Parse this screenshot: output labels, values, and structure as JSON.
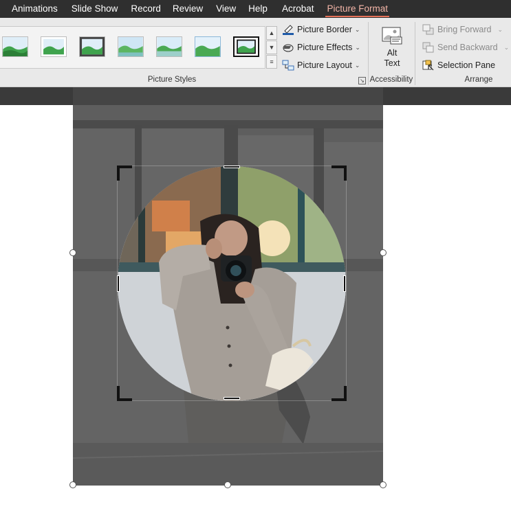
{
  "menu": {
    "tabs": [
      {
        "label": "Animations",
        "active": false
      },
      {
        "label": "Slide Show",
        "active": false
      },
      {
        "label": "Record",
        "active": false
      },
      {
        "label": "Review",
        "active": false
      },
      {
        "label": "View",
        "active": false
      },
      {
        "label": "Help",
        "active": false
      },
      {
        "label": "Acrobat",
        "active": false
      },
      {
        "label": "Picture Format",
        "active": true
      }
    ]
  },
  "ribbon": {
    "picture_styles": {
      "group_label": "Picture Styles",
      "thumbnail_icon": "landscape-thumbnail-icon",
      "commands": {
        "border": "Picture Border",
        "effects": "Picture Effects",
        "layout": "Picture Layout"
      }
    },
    "accessibility": {
      "group_label": "Accessibility",
      "alt_text_line1": "Alt",
      "alt_text_line2": "Text"
    },
    "arrange": {
      "group_label": "Arrange",
      "bring_forward": "Bring Forward",
      "send_backward": "Send Backward",
      "selection_pane": "Selection Pane"
    }
  },
  "colors": {
    "menubar_bg": "#2f2f2f",
    "active_tab_text": "#f4b6a8",
    "active_tab_underline": "#e8735a",
    "ribbon_bg": "#e9e9e9"
  }
}
